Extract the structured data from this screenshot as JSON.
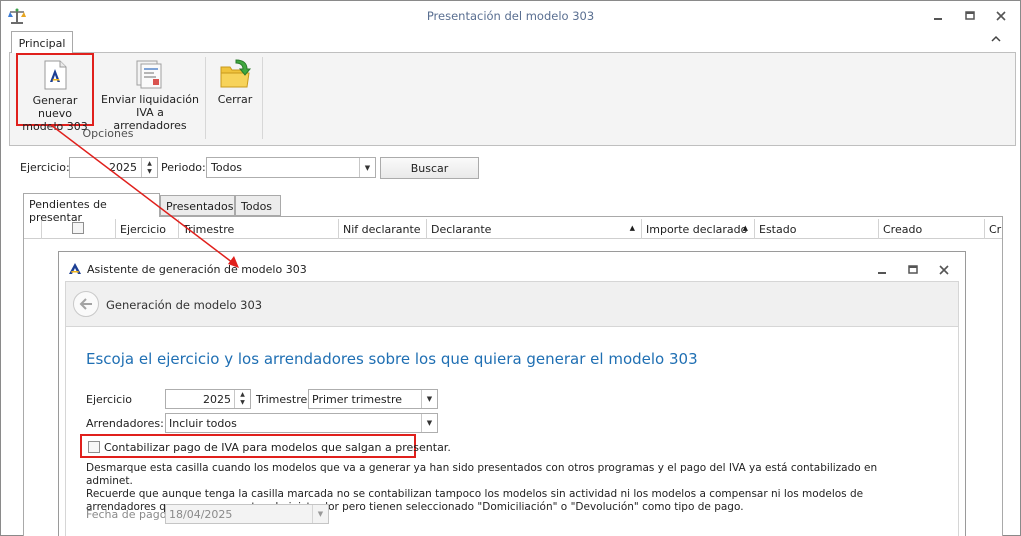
{
  "window": {
    "title": "Presentación del modelo 303",
    "app_icon": "scales-app-icon",
    "controls": [
      "minimize-icon",
      "maximize-icon",
      "close-icon"
    ]
  },
  "ribbon": {
    "tab": "Principal",
    "group_label": "Opciones",
    "buttons": {
      "generar": {
        "line1": "Generar nuevo",
        "line2": "modelo 303",
        "icon": "tax-agency-document-icon"
      },
      "enviar": {
        "line1": "Enviar liquidación",
        "line2": "IVA a arrendadores",
        "icon": "documents-send-icon"
      },
      "cerrar": {
        "line1": "Cerrar",
        "icon": "folder-exit-icon"
      }
    }
  },
  "filters": {
    "ejercicio_label": "Ejercicio:",
    "ejercicio_value": "2025",
    "periodo_label": "Periodo:",
    "periodo_value": "Todos",
    "buscar_label": "Buscar"
  },
  "tabs": [
    "Pendientes de presentar",
    "Presentados",
    "Todos"
  ],
  "grid": {
    "columns": [
      "Ejercicio",
      "Trimestre",
      "Nif declarante",
      "Declarante",
      "Importe declarado",
      "Estado",
      "Creado",
      "Cr"
    ]
  },
  "dialog": {
    "title": "Asistente de generación de modelo 303",
    "wizard_title": "Generación de modelo 303",
    "heading": "Escoja el ejercicio y los arrendadores sobre los que quiera generar el modelo 303",
    "ejercicio_label": "Ejercicio",
    "ejercicio_value": "2025",
    "trimestre_label": "Trimestre:",
    "trimestre_value": "Primer trimestre",
    "arrendadores_label": "Arrendadores:",
    "arrendadores_value": "Incluir todos",
    "checkbox_label": "Contabilizar pago de IVA para modelos que salgan a presentar.",
    "checkbox_checked": false,
    "help_line1": "Desmarque esta casilla cuando los modelos que va a generar ya han sido presentados con otros programas y el pago del IVA ya está contabilizado en adminet.",
    "help_line2": "Recuerde que aunque tenga la casilla marcada no se contabilizan tampoco los modelos sin actividad ni los modelos a compensar ni los modelos de arrendadores que van por cuenta administrador pero tienen seleccionado \"Domiciliación\" o \"Devolución\" como tipo de pago.",
    "fecha_label": "Fecha de pago:",
    "fecha_value": "18/04/2025"
  },
  "colors": {
    "highlight": "#e0201c",
    "heading": "#1f6fb3",
    "title_text": "#5a6f91"
  }
}
